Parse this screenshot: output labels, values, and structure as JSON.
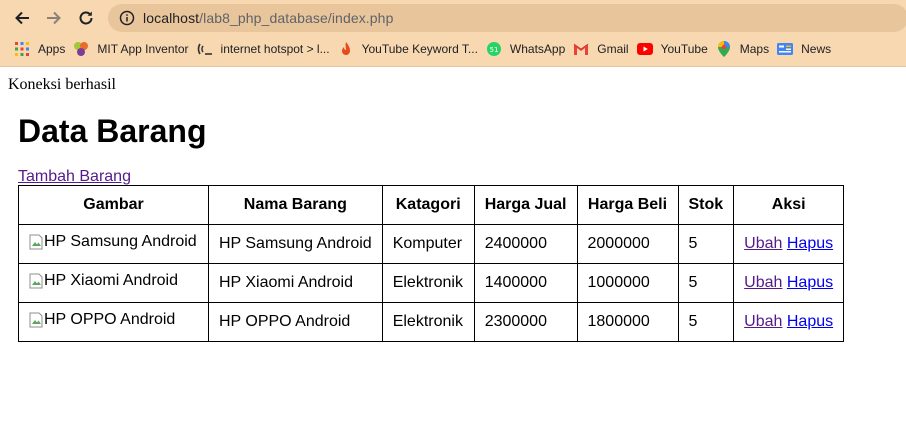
{
  "browser": {
    "url_host": "localhost",
    "url_path": "/lab8_php_database/index.php",
    "bookmarks": [
      {
        "label": "Apps",
        "icon": "apps-grid-icon"
      },
      {
        "label": "MIT App Inventor",
        "icon": "mit-app-inventor-icon"
      },
      {
        "label": "internet hotspot > l...",
        "icon": "hotspot-icon"
      },
      {
        "label": "YouTube Keyword T...",
        "icon": "keyword-tool-icon"
      },
      {
        "label": "WhatsApp",
        "icon": "whatsapp-icon"
      },
      {
        "label": "Gmail",
        "icon": "gmail-icon"
      },
      {
        "label": "YouTube",
        "icon": "youtube-icon"
      },
      {
        "label": "Maps",
        "icon": "maps-icon"
      },
      {
        "label": "News",
        "icon": "news-icon"
      }
    ]
  },
  "page": {
    "status_text": "Koneksi berhasil",
    "title": "Data Barang",
    "add_link": "Tambah Barang",
    "columns": [
      "Gambar",
      "Nama Barang",
      "Katagori",
      "Harga Jual",
      "Harga Beli",
      "Stok",
      "Aksi"
    ],
    "rows": [
      {
        "image_alt": "HP Samsung Android",
        "nama": "HP Samsung Android",
        "kategori": "Komputer",
        "harga_jual": "2400000",
        "harga_beli": "2000000",
        "stok": "5",
        "ubah": "Ubah",
        "hapus": "Hapus"
      },
      {
        "image_alt": "HP Xiaomi Android",
        "nama": "HP Xiaomi Android",
        "kategori": "Elektronik",
        "harga_jual": "1400000",
        "harga_beli": "1000000",
        "stok": "5",
        "ubah": "Ubah",
        "hapus": "Hapus"
      },
      {
        "image_alt": "HP OPPO Android",
        "nama": "HP OPPO Android",
        "kategori": "Elektronik",
        "harga_jual": "2300000",
        "harga_beli": "1800000",
        "stok": "5",
        "ubah": "Ubah",
        "hapus": "Hapus"
      }
    ]
  }
}
